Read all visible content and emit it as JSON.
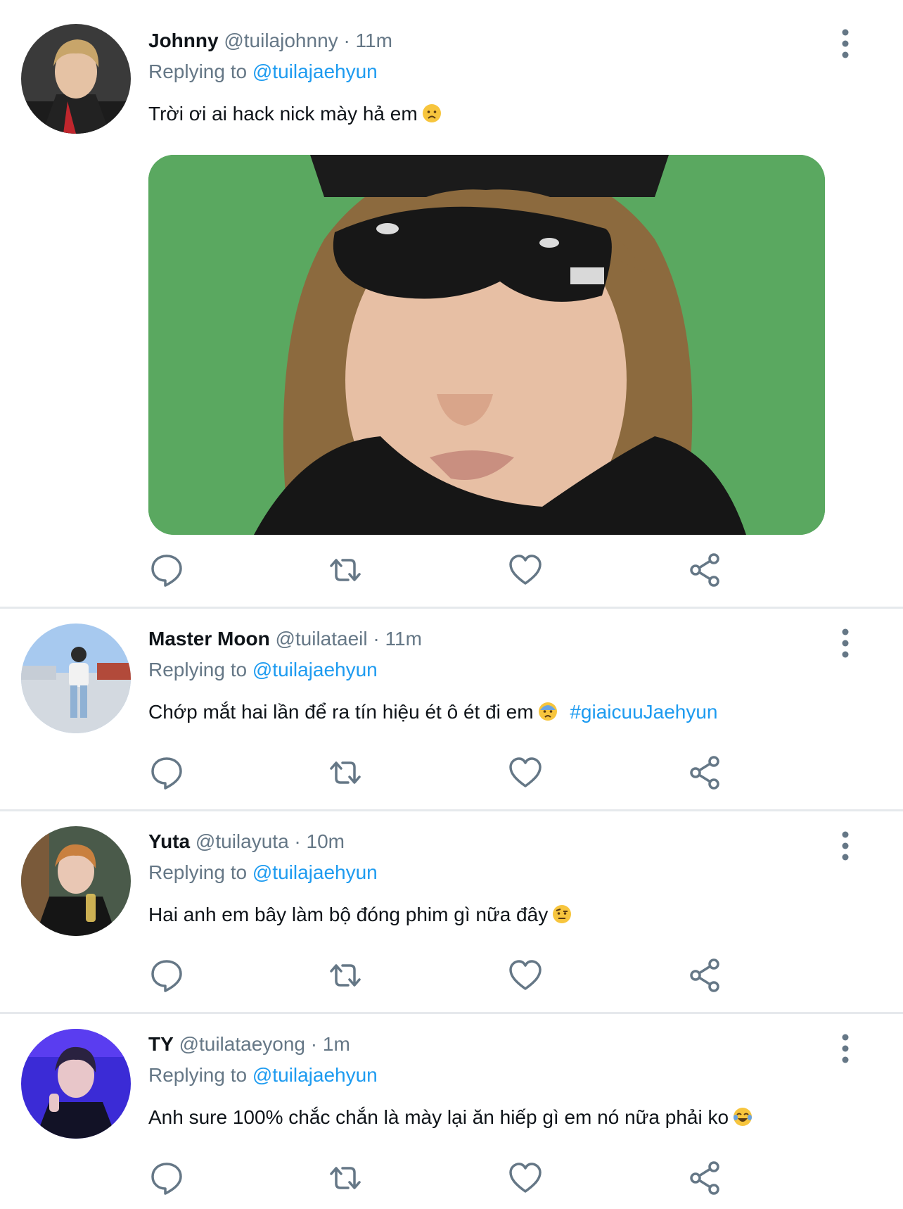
{
  "colors": {
    "link": "#1d9bf0",
    "muted": "#657786",
    "divider": "#e6e9ec",
    "text": "#0f1419"
  },
  "tweets": [
    {
      "name": "Johnny",
      "handle": "@tuilajohnny",
      "separator": "·",
      "time": "11m",
      "replying_prefix": "Replying to",
      "replying_handle": "@tuilajaehyun",
      "text": "Trời ơi ai hack nick mày hả em",
      "emoji": "frowning-face-emoji",
      "has_media": true
    },
    {
      "name": "Master Moon",
      "handle": "@tuilataeil",
      "separator": "·",
      "time": "11m",
      "replying_prefix": "Replying to",
      "replying_handle": "@tuilajaehyun",
      "text": "Chớp mắt hai lần để ra tín hiệu ét ô ét đi em",
      "emoji": "anxious-face-emoji",
      "hashtag": "#giaicuuJaehyun"
    },
    {
      "name": "Yuta",
      "handle": "@tuilayuta",
      "separator": "·",
      "time": "10m",
      "replying_prefix": "Replying to",
      "replying_handle": "@tuilajaehyun",
      "text": "Hai anh em bây làm bộ đóng phim gì nữa đây",
      "emoji": "raised-eyebrow-emoji"
    },
    {
      "name": "TY",
      "handle": "@tuilataeyong",
      "separator": "·",
      "time": "1m",
      "replying_prefix": "Replying to",
      "replying_handle": "@tuilajaehyun",
      "text": "Anh sure 100% chắc chắn là mày lại ăn hiếp gì em nó nữa phải ko",
      "emoji": "tears-of-joy-emoji"
    }
  ],
  "action_icons": [
    "reply-icon",
    "retweet-icon",
    "like-icon",
    "share-icon"
  ]
}
